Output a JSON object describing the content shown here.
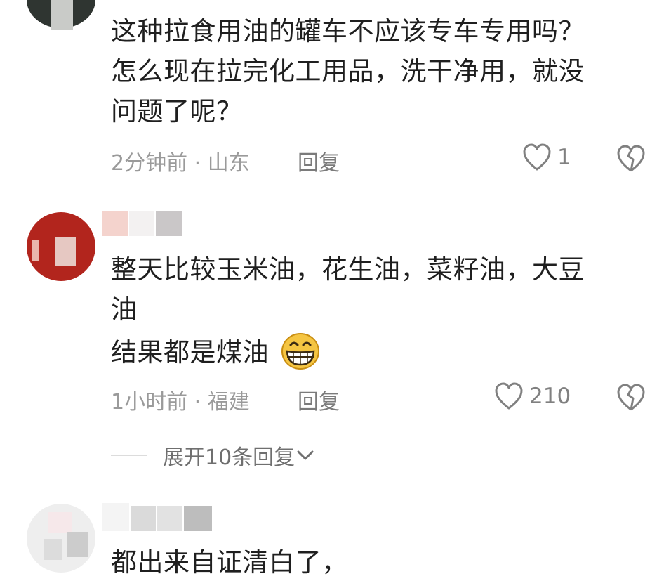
{
  "comments": [
    {
      "lines": [
        "这种拉食用油的罐车不应该专车专用吗？",
        "怎么现在拉完化工用品，洗干净用，就没",
        "问题了呢？"
      ],
      "time": "2分钟前",
      "location": "山东",
      "reply_label": "回复",
      "likes": "1"
    },
    {
      "lines": [
        "整天比较玉米油，花生油，菜籽油，大豆",
        "油",
        "结果都是煤油"
      ],
      "emoji": "grinning-face-emoji",
      "time": "1小时前",
      "location": "福建",
      "reply_label": "回复",
      "likes": "210",
      "expand_replies": "展开10条回复"
    },
    {
      "lines": [
        "都出来自证清白了，"
      ]
    }
  ],
  "meta_separator": " · ",
  "icons": [
    "heart-icon",
    "broken-heart-icon",
    "chevron-down-icon"
  ],
  "colors": {
    "text": "#1f1f1f",
    "meta": "#9a9a9a",
    "icon": "#808080",
    "emoji": "#f5c542"
  }
}
